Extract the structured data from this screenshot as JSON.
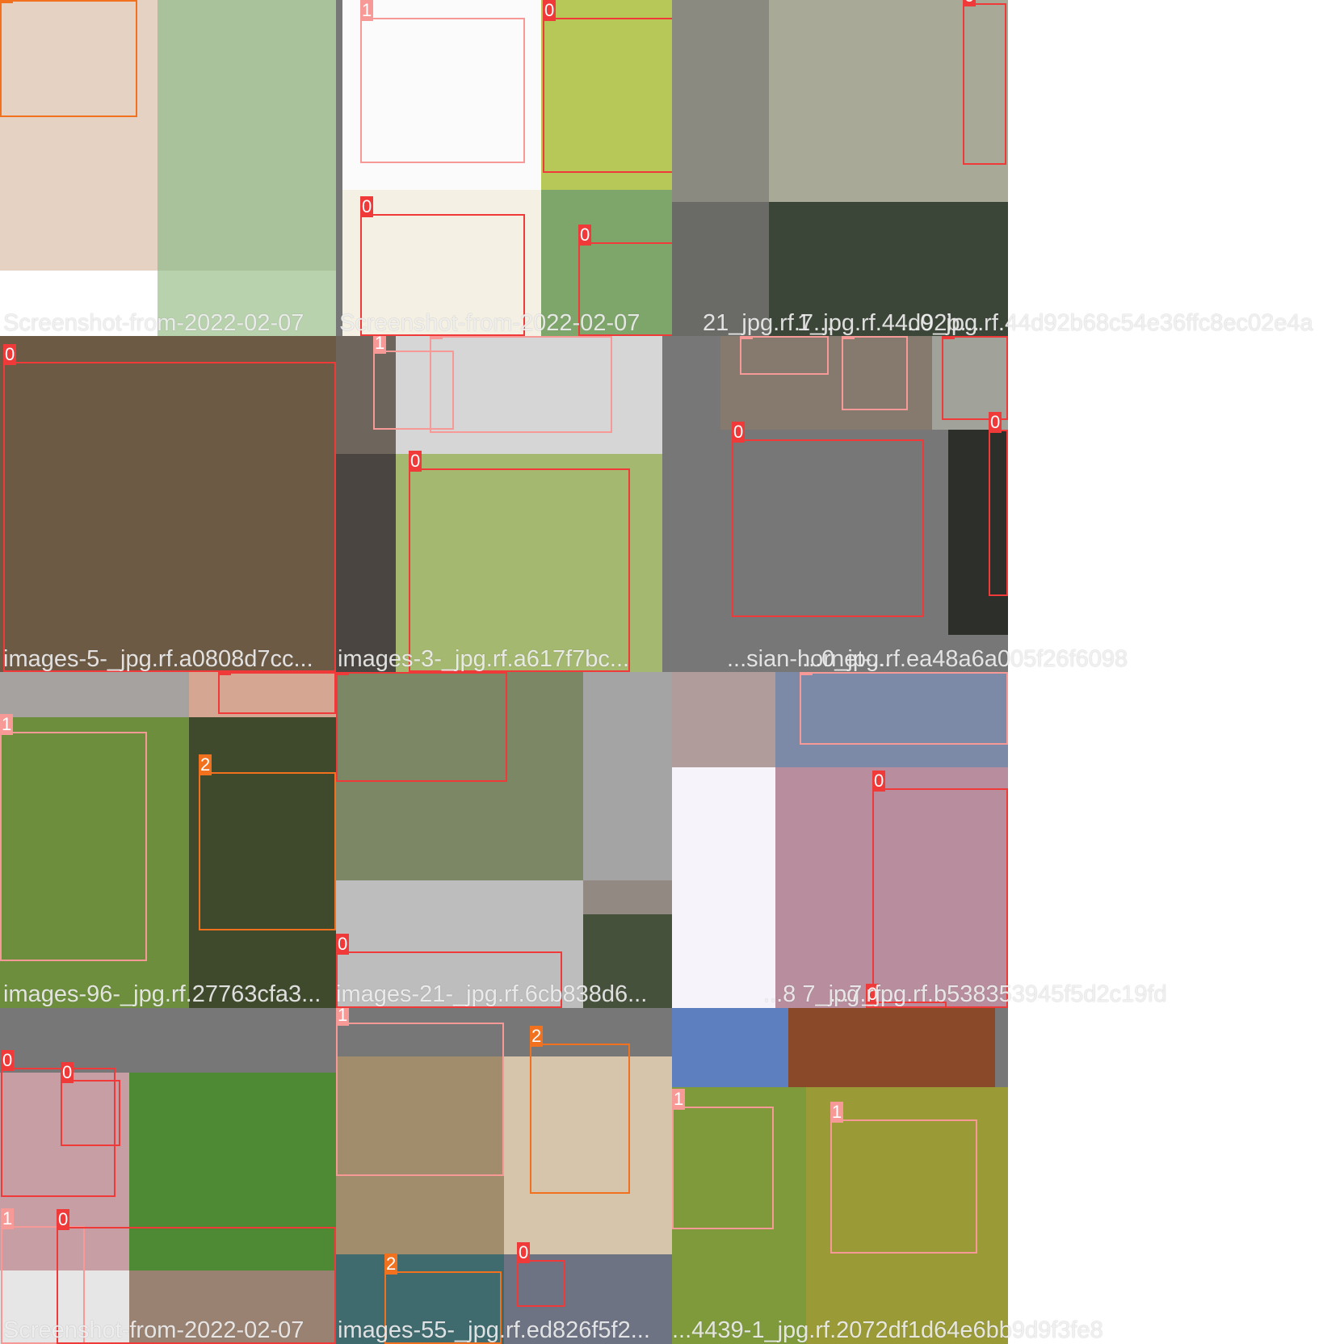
{
  "colors": {
    "class_0": "#f03a3a",
    "class_1": "#f79a97",
    "class_2": "#f2711f",
    "background": "#ffffff",
    "cell_fill": "#777777"
  },
  "class_labels": [
    "0",
    "1",
    "2"
  ],
  "captions": [
    "Screenshot-from-2022-02-07",
    "Screenshot-from-2022-02-07",
    "21_jpg.rf.7...",
    "1_jpg.rf.44d92b...",
    "...0_jpg.rf.44d92b68c54e36ffc8ec02e4a",
    "images-5-_jpg.rf.a0808d7cc...",
    "images-3-_jpg.rf.a617f7bc...",
    "...sian-hornet-...",
    "...0_jpg.rf.ea48a6a005f26f6098",
    "images-96-_jpg.rf.27763cfa3...",
    "images-21-_jpg.rf.6cb838d6...",
    "...8 7_jpg.rf...",
    "...7_jpg.rf.b538353945f5d2c19fd",
    "Screenshot-from-2022-02-07",
    "images-55-_jpg.rf.ed826f5f2...",
    "...4439-1_jpg.rf.2072df1d64e6bb9d9f3fe8"
  ],
  "cells": [
    {
      "tiles": [
        {
          "color": "#e6d2c2"
        },
        {
          "color": "#a9c29b"
        },
        {
          "color": "#ffffff"
        },
        {
          "color": "#b9d2ae"
        }
      ],
      "boxes": [
        {
          "cls": 2
        }
      ]
    },
    {
      "tiles": [
        {
          "color": "#fbfbfb"
        },
        {
          "color": "#b8c858"
        },
        {
          "color": "#f5f0e4"
        },
        {
          "color": "#7fa66a"
        }
      ],
      "boxes": [
        {
          "cls": 1
        },
        {
          "cls": 0
        },
        {
          "cls": 0
        },
        {
          "cls": 0
        }
      ]
    },
    {
      "tiles": [
        {
          "color": "#8a8a80"
        },
        {
          "color": "#a8a996"
        },
        {
          "color": "#6a6a66"
        },
        {
          "color": "#3c4638"
        }
      ],
      "boxes": [
        {
          "cls": 0
        }
      ]
    },
    {
      "tiles": [
        {
          "color": "#6d5a45"
        }
      ],
      "boxes": [
        {
          "cls": 0
        }
      ]
    },
    {
      "tiles": [
        {
          "color": "#6e665c"
        },
        {
          "color": "#d6d6d6"
        },
        {
          "color": "#4a4540"
        },
        {
          "color": "#a5b870"
        }
      ],
      "boxes": [
        {
          "cls": 1
        },
        {
          "cls": 1
        },
        {
          "cls": 0
        }
      ]
    },
    {
      "tiles": [
        {
          "color": "#867a6e"
        },
        {
          "color": "#a1a29a"
        },
        {
          "color": "#2c2f2a"
        }
      ],
      "boxes": [
        {
          "cls": 1
        },
        {
          "cls": 1
        },
        {
          "cls": 0
        },
        {
          "cls": 0
        },
        {
          "cls": 0
        }
      ]
    },
    {
      "tiles": [
        {
          "color": "#a6a2a0"
        },
        {
          "color": "#d5a793"
        },
        {
          "color": "#6d8e3c"
        },
        {
          "color": "#3f4a2c"
        }
      ],
      "boxes": [
        {
          "cls": 0
        },
        {
          "cls": 1
        },
        {
          "cls": 2
        }
      ]
    },
    {
      "tiles": [
        {
          "color": "#7c8766"
        },
        {
          "color": "#a4a4a4"
        },
        {
          "color": "#bdbdbd"
        },
        {
          "color": "#928a82"
        },
        {
          "color": "#46513c"
        }
      ],
      "boxes": [
        {
          "cls": 0
        },
        {
          "cls": 0
        }
      ]
    },
    {
      "tiles": [
        {
          "color": "#b09c9a"
        },
        {
          "color": "#7c8aa8"
        },
        {
          "color": "#f6f3fb"
        },
        {
          "color": "#b88e9e"
        }
      ],
      "boxes": [
        {
          "cls": 1
        },
        {
          "cls": 0
        },
        {
          "cls": 0
        }
      ]
    },
    {
      "tiles": [
        {
          "color": "#c79ea4"
        },
        {
          "color": "#4e8a34"
        },
        {
          "color": "#e6e6e6"
        },
        {
          "color": "#9a8272"
        }
      ],
      "boxes": [
        {
          "cls": 0
        },
        {
          "cls": 0
        },
        {
          "cls": 1
        },
        {
          "cls": 0
        }
      ]
    },
    {
      "tiles": [
        {
          "color": "#a18c6c"
        },
        {
          "color": "#d6c5aa"
        },
        {
          "color": "#3f6a6e"
        },
        {
          "color": "#6e7384"
        }
      ],
      "boxes": [
        {
          "cls": 1
        },
        {
          "cls": 2
        },
        {
          "cls": 0
        },
        {
          "cls": 2
        }
      ]
    },
    {
      "tiles": [
        {
          "color": "#5d7fc0"
        },
        {
          "color": "#8a4a2a"
        },
        {
          "color": "#7e9a3a"
        },
        {
          "color": "#9a9a36"
        }
      ],
      "boxes": [
        {
          "cls": 1
        },
        {
          "cls": 1
        }
      ]
    }
  ]
}
